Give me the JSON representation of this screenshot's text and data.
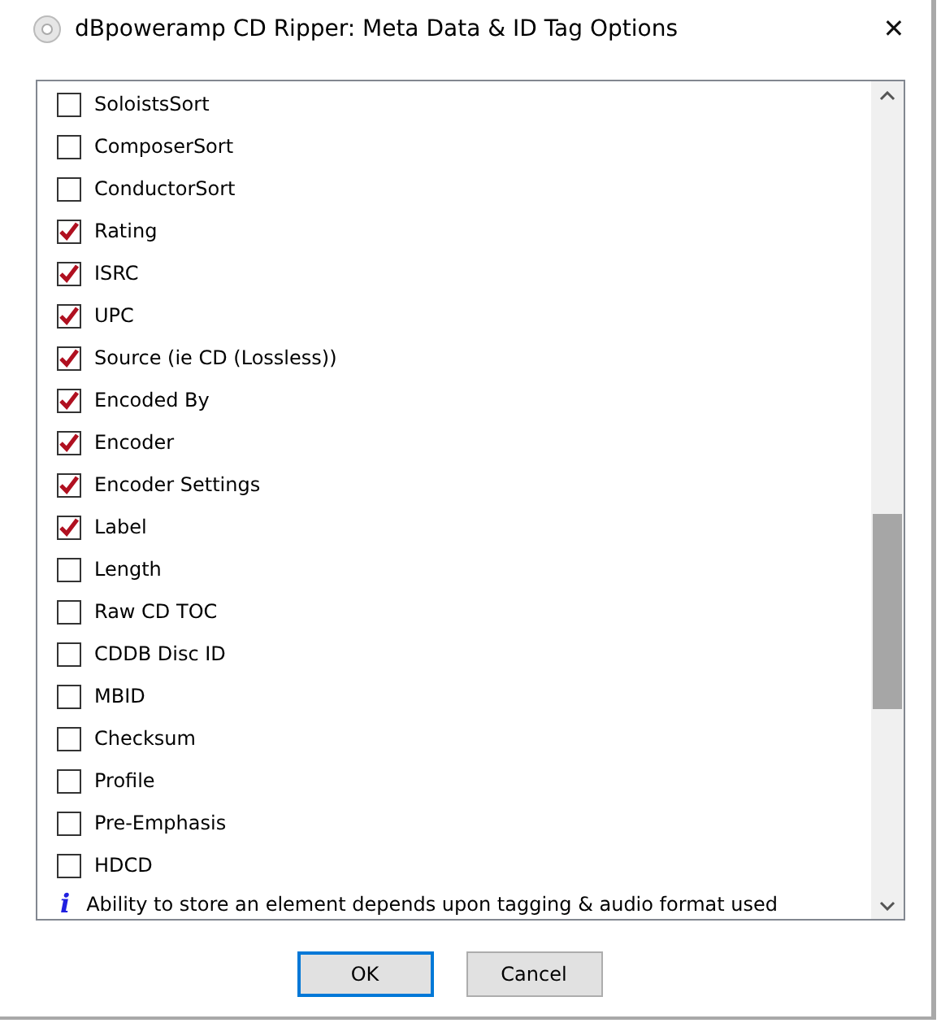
{
  "window": {
    "title": "dBpoweramp CD Ripper: Meta Data & ID Tag Options",
    "close": "✕"
  },
  "tags": [
    {
      "label": "SoloistsSort",
      "checked": false
    },
    {
      "label": "ComposerSort",
      "checked": false
    },
    {
      "label": "ConductorSort",
      "checked": false
    },
    {
      "label": "Rating",
      "checked": true
    },
    {
      "label": "ISRC",
      "checked": true
    },
    {
      "label": "UPC",
      "checked": true
    },
    {
      "label": "Source (ie CD (Lossless))",
      "checked": true
    },
    {
      "label": "Encoded By",
      "checked": true
    },
    {
      "label": "Encoder",
      "checked": true
    },
    {
      "label": "Encoder Settings",
      "checked": true
    },
    {
      "label": "Label",
      "checked": true
    },
    {
      "label": "Length",
      "checked": false
    },
    {
      "label": "Raw CD TOC",
      "checked": false
    },
    {
      "label": "CDDB Disc ID",
      "checked": false
    },
    {
      "label": "MBID",
      "checked": false
    },
    {
      "label": "Checksum",
      "checked": false
    },
    {
      "label": "Profile",
      "checked": false
    },
    {
      "label": "Pre-Emphasis",
      "checked": false
    },
    {
      "label": "HDCD",
      "checked": false
    }
  ],
  "info": {
    "icon": "i",
    "text": "Ability to store an element depends upon tagging & audio format used"
  },
  "buttons": [
    {
      "label": "OK",
      "selected": true
    },
    {
      "label": "Cancel",
      "selected": false
    }
  ]
}
